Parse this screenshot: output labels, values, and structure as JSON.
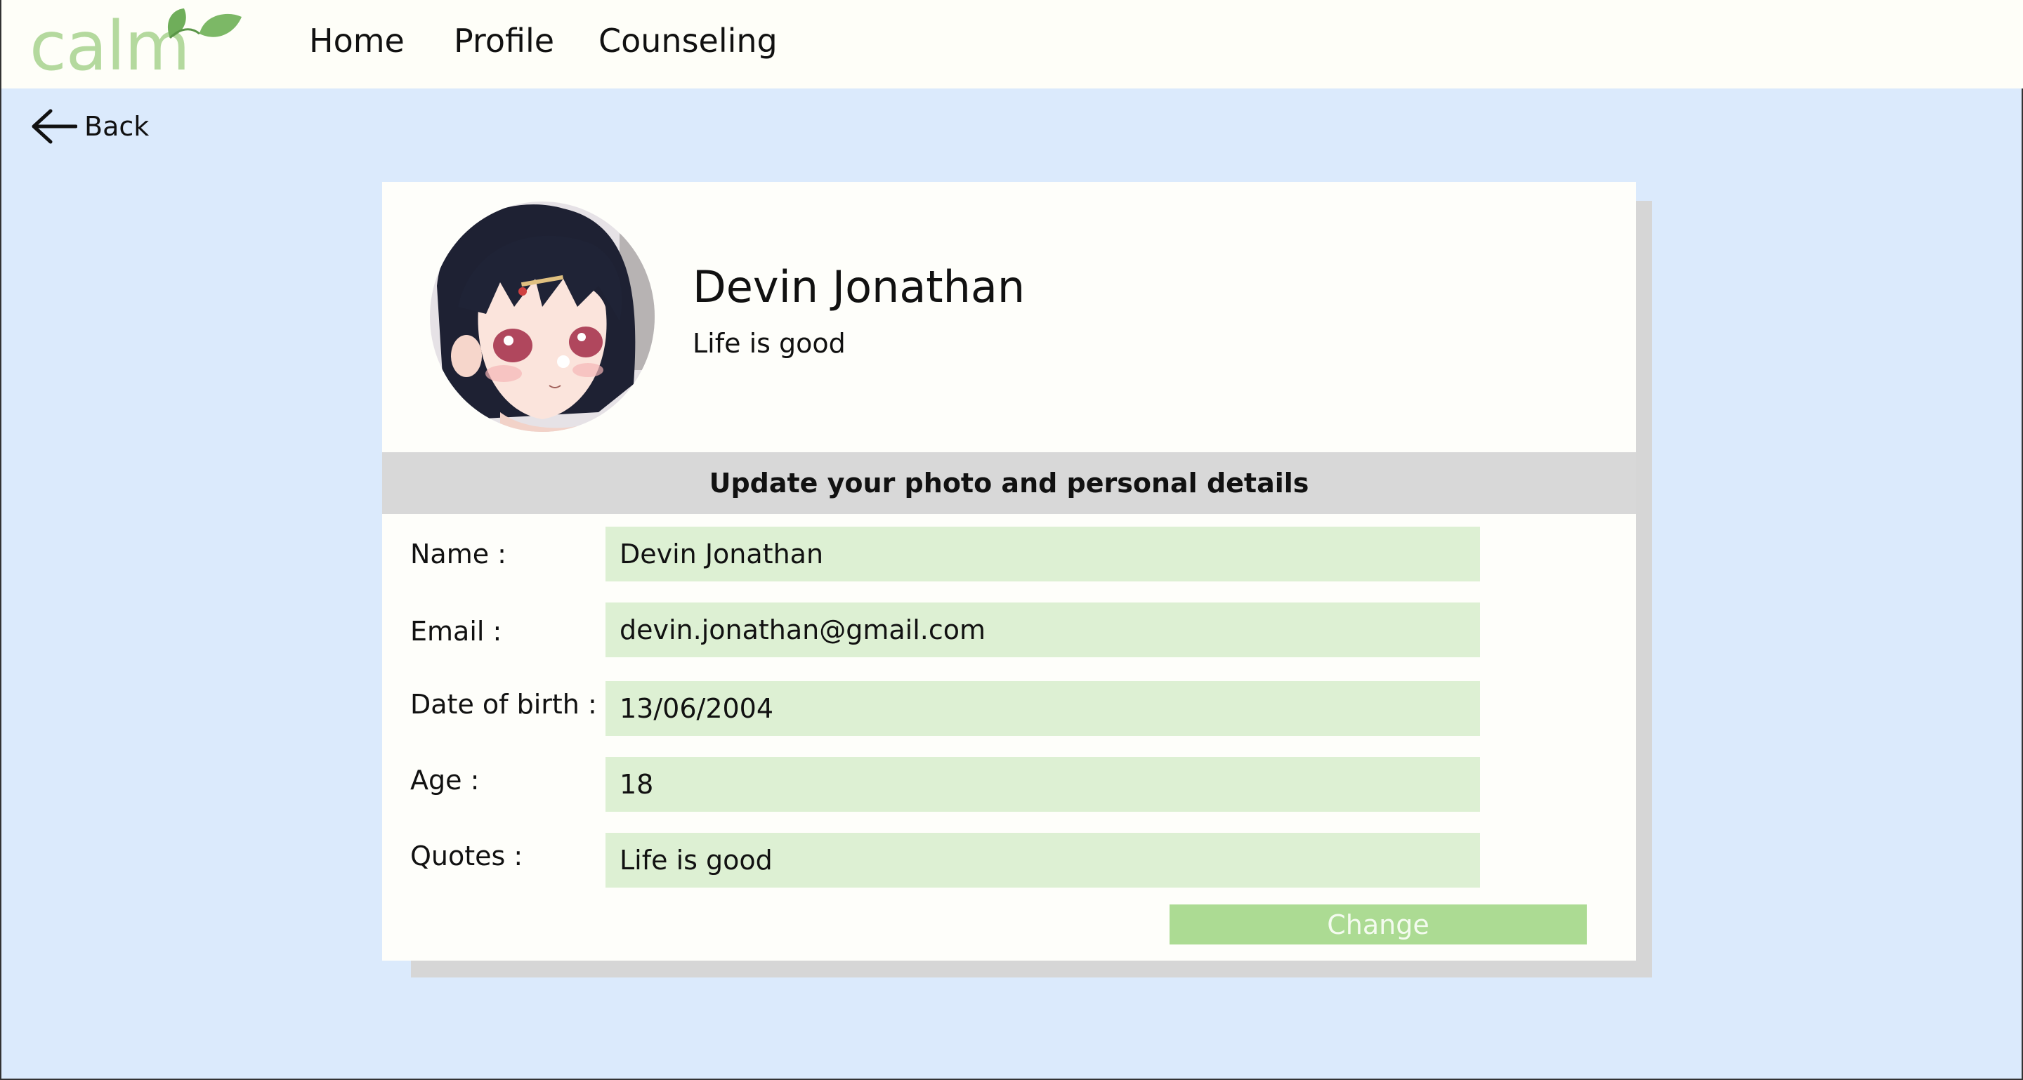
{
  "app": {
    "logo_text": "calm",
    "brand_color": "#b4d99e",
    "leaf_color": "#6fae5a"
  },
  "nav": {
    "items": [
      {
        "label": "Home"
      },
      {
        "label": "Profile"
      },
      {
        "label": "Counseling"
      }
    ]
  },
  "back": {
    "label": "Back",
    "icon": "arrow-left-icon"
  },
  "profile": {
    "name": "Devin Jonathan",
    "quote": "Life is good",
    "avatar_icon": "avatar-anime-girl"
  },
  "form": {
    "section_title": "Update your photo and personal details",
    "fields": [
      {
        "label": "Name :",
        "value": "Devin Jonathan"
      },
      {
        "label": "Email :",
        "value": "devin.jonathan@gmail.com"
      },
      {
        "label": "Date of birth :",
        "value": "13/06/2004"
      },
      {
        "label": "Age :",
        "value": "18"
      },
      {
        "label": "Quotes :",
        "value": "Life is good"
      }
    ],
    "submit_label": "Change"
  },
  "colors": {
    "page_bg": "#dbeafc",
    "topbar_bg": "#fefef8",
    "field_bg": "#ddf0d3",
    "button_bg": "#acdb93",
    "section_bar_bg": "#d8d8d8"
  }
}
